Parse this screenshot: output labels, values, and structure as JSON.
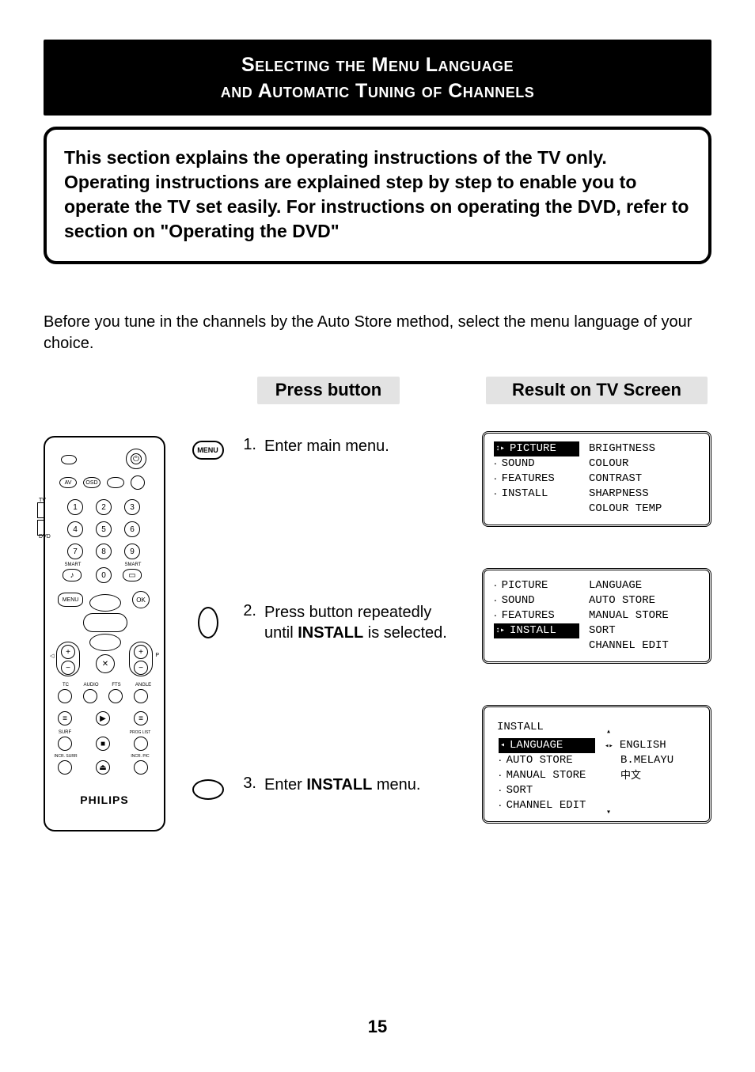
{
  "title": {
    "line1": "Selecting the Menu Language",
    "line2": "and Automatic Tuning of Channels"
  },
  "intro": "This section explains the operating instructions of the TV only. Operating instructions are explained step by step to enable you to operate the TV set easily. For instructions on operating the DVD, refer to section on \"Operating the DVD\"",
  "before": "Before you tune in the channels by the Auto Store method, select the menu language of your choice.",
  "headers": {
    "press": "Press button",
    "result": "Result on TV Screen"
  },
  "remote": {
    "brand": "PHILIPS",
    "side_labels": {
      "top": "TV",
      "bottom": "DVD"
    },
    "top_labels": {
      "av": "AV",
      "osd": "OSD"
    },
    "smart_left": "SMART",
    "smart_right": "SMART",
    "nums": [
      "1",
      "2",
      "3",
      "4",
      "5",
      "6",
      "7",
      "8",
      "9",
      "0"
    ],
    "menu": "MENU",
    "ok": "OK",
    "row_labels": [
      "TC",
      "AUDIO",
      "FTS",
      "ANGLE"
    ],
    "row2_labels": [
      "",
      "",
      "",
      ""
    ],
    "row3_labels": [
      "SURF",
      "",
      "PROG LIST"
    ],
    "row4_labels": [
      "INCR. SURR",
      "",
      "INCR. PIC"
    ]
  },
  "steps": [
    {
      "icon": "menu",
      "number": "1.",
      "text_parts": [
        "Enter main menu."
      ],
      "osd": {
        "left": [
          {
            "label": "PICTURE",
            "highlight": true,
            "arrow": true
          },
          {
            "label": "SOUND",
            "highlight": false
          },
          {
            "label": "FEATURES",
            "highlight": false
          },
          {
            "label": "INSTALL",
            "highlight": false
          }
        ],
        "right": [
          "BRIGHTNESS",
          "COLOUR",
          "CONTRAST",
          "SHARPNESS",
          "COLOUR TEMP"
        ]
      }
    },
    {
      "icon": "down",
      "number": "2.",
      "text_parts": [
        "Press button repeatedly until ",
        {
          "bold": "INSTALL"
        },
        " is selected."
      ],
      "osd": {
        "left": [
          {
            "label": "PICTURE",
            "highlight": false
          },
          {
            "label": "SOUND",
            "highlight": false
          },
          {
            "label": "FEATURES",
            "highlight": false
          },
          {
            "label": "INSTALL",
            "highlight": true,
            "arrow": true
          }
        ],
        "right": [
          "LANGUAGE",
          "AUTO STORE",
          "MANUAL STORE",
          "SORT",
          "CHANNEL EDIT"
        ]
      }
    },
    {
      "icon": "right",
      "number": "3.",
      "text_parts": [
        "Enter ",
        {
          "bold": "INSTALL"
        },
        " menu."
      ],
      "osd_install": {
        "title": "INSTALL",
        "left": [
          {
            "label": "LANGUAGE",
            "highlight": true,
            "left_arrow": true
          },
          {
            "label": "AUTO STORE"
          },
          {
            "label": "MANUAL STORE"
          },
          {
            "label": "SORT"
          },
          {
            "label": "CHANNEL EDIT"
          }
        ],
        "right": [
          {
            "label": "ENGLISH",
            "arrow": true,
            "up": true
          },
          {
            "label": "B.MELAYU"
          },
          {
            "label": "中文",
            "cjk": true
          }
        ]
      }
    }
  ],
  "page_number": "15",
  "icons": {
    "menu_text": "MENU"
  }
}
